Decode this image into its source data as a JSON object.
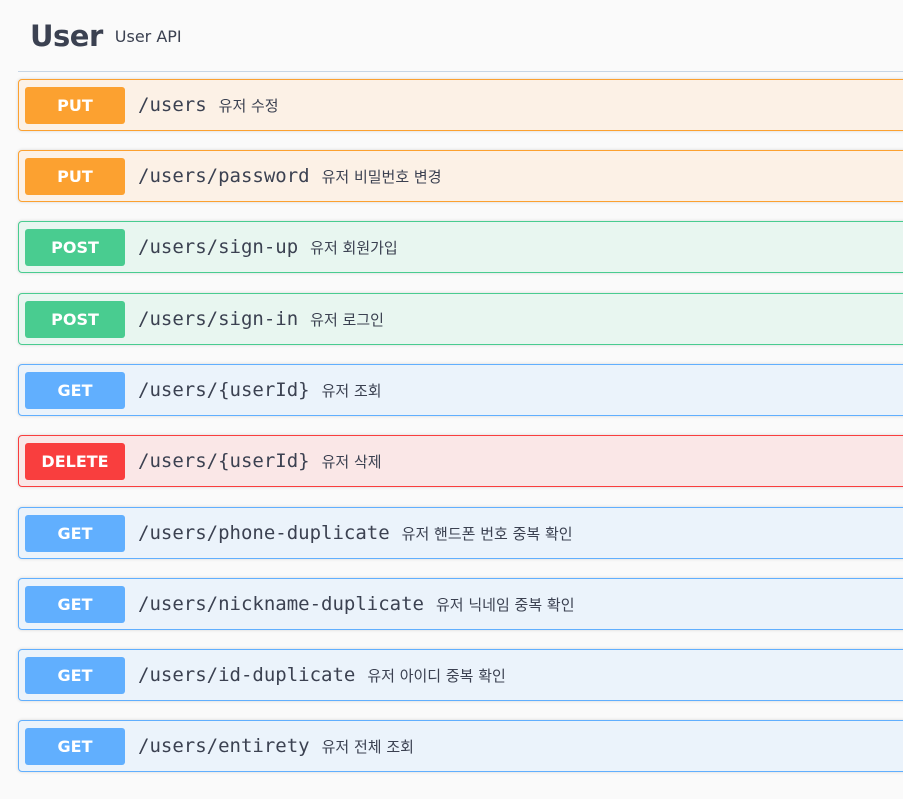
{
  "tag": {
    "name": "User",
    "description": "User API"
  },
  "operations": [
    {
      "method": "PUT",
      "path": "/users",
      "summary": "유저 수정"
    },
    {
      "method": "PUT",
      "path": "/users/password",
      "summary": "유저 비밀번호 변경"
    },
    {
      "method": "POST",
      "path": "/users/sign-up",
      "summary": "유저 회원가입"
    },
    {
      "method": "POST",
      "path": "/users/sign-in",
      "summary": "유저 로그인"
    },
    {
      "method": "GET",
      "path": "/users/{userId}",
      "summary": "유저 조회"
    },
    {
      "method": "DELETE",
      "path": "/users/{userId}",
      "summary": "유저 삭제"
    },
    {
      "method": "GET",
      "path": "/users/phone-duplicate",
      "summary": "유저 핸드폰 번호 중복 확인"
    },
    {
      "method": "GET",
      "path": "/users/nickname-duplicate",
      "summary": "유저 닉네임 중복 확인"
    },
    {
      "method": "GET",
      "path": "/users/id-duplicate",
      "summary": "유저 아이디 중복 확인"
    },
    {
      "method": "GET",
      "path": "/users/entirety",
      "summary": "유저 전체 조회"
    }
  ],
  "colors": {
    "put": "#fca130",
    "post": "#49cc90",
    "get": "#61affe",
    "delete": "#f93e3e",
    "text": "#3b4151"
  }
}
